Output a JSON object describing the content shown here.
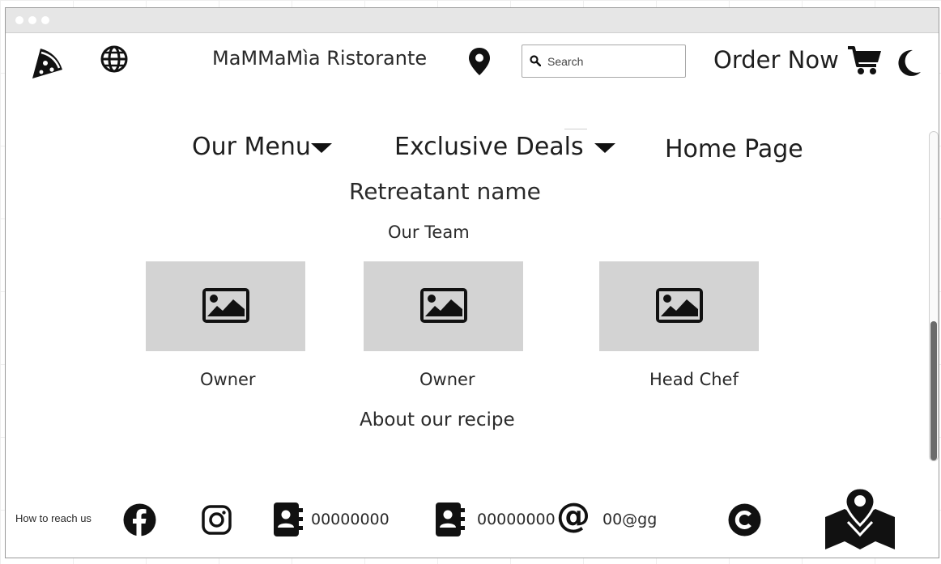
{
  "header": {
    "brand": "MaMMaMìa Ristorante",
    "search_placeholder": "Search",
    "order_label": "Order Now"
  },
  "nav": {
    "menu_label": "Our Menu",
    "deals_label": "Exclusive Deals",
    "home_label": "Home Page"
  },
  "main": {
    "title": "Retreatant name",
    "team_heading": "Our Team",
    "team": [
      {
        "role": "Owner"
      },
      {
        "role": "Owner"
      },
      {
        "role": "Head Chef"
      }
    ],
    "recipe_heading": "About our recipe"
  },
  "footer": {
    "reach_label": "How to reach us",
    "phone1": "00000000",
    "phone2": "00000000",
    "email": "00@gg"
  },
  "colors": {
    "icon": "#111111",
    "placeholder_bg": "#d3d3d3",
    "titlebar": "#e6e6e6"
  },
  "icons": [
    "pizza-icon",
    "globe-icon",
    "map-pin-icon",
    "search-icon",
    "cart-icon",
    "moon-icon",
    "caret-down-icon",
    "image-icon",
    "facebook-icon",
    "instagram-icon",
    "contact-book-icon",
    "at-sign-icon",
    "copyright-icon",
    "map-icon"
  ]
}
